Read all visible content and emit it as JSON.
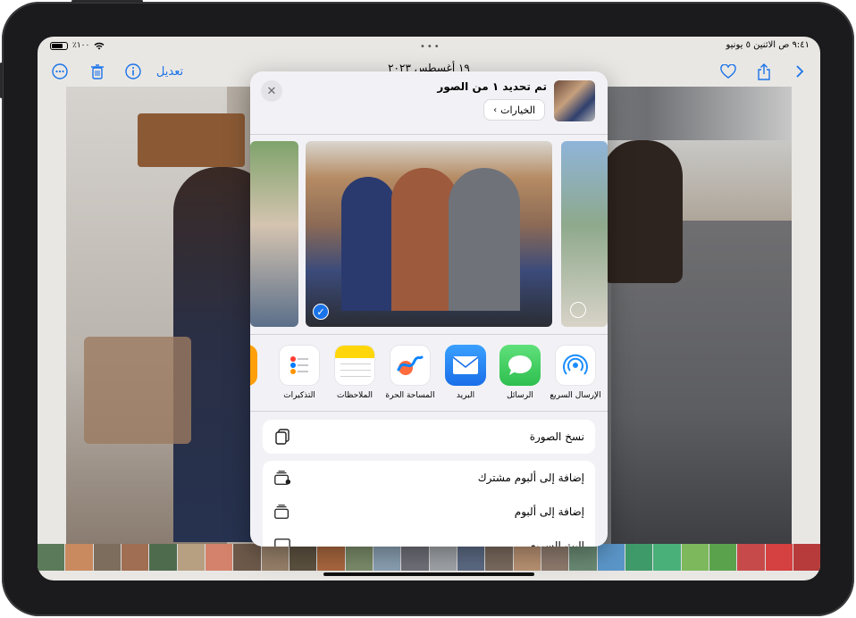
{
  "status_bar": {
    "time_date": "٩:٤١ ص  الاثنين ٥ يونيو",
    "battery_percent": "٪١٠٠"
  },
  "toolbar": {
    "date": "١٩ أغسطس ٢٠٢٣",
    "edit": "تعديل",
    "icons": [
      "more-icon",
      "trash-icon",
      "info-icon",
      "heart-icon",
      "share-icon",
      "chevron-right-icon"
    ]
  },
  "share_sheet": {
    "title": "تم تحديد ١ من الصور",
    "options": "الخيارات",
    "apps": [
      {
        "label": "الإرسال السريع",
        "icon": "airdrop-icon",
        "color": "#ffffff"
      },
      {
        "label": "الرسائل",
        "icon": "messages-icon",
        "color": "#34c759"
      },
      {
        "label": "البريد",
        "icon": "mail-icon",
        "color": "#1a8cff"
      },
      {
        "label": "المساحة الحرة",
        "icon": "freeform-icon",
        "color": "#ffffff"
      },
      {
        "label": "الملاحظات",
        "icon": "notes-icon",
        "color": "#ffffff"
      },
      {
        "label": "التذكيرات",
        "icon": "reminders-icon",
        "color": "#ffffff"
      }
    ],
    "actions": [
      {
        "label": "نسخ الصورة",
        "icon": "copy-icon"
      },
      {
        "label": "إضافة إلى ألبوم مشترك",
        "icon": "shared-album-icon"
      },
      {
        "label": "إضافة إلى ألبوم",
        "icon": "album-icon"
      },
      {
        "label": "البث السريع",
        "icon": "airplay-icon"
      }
    ]
  },
  "colors": {
    "accent": "#1a73e8",
    "sheet_bg": "#f2f2f6"
  }
}
